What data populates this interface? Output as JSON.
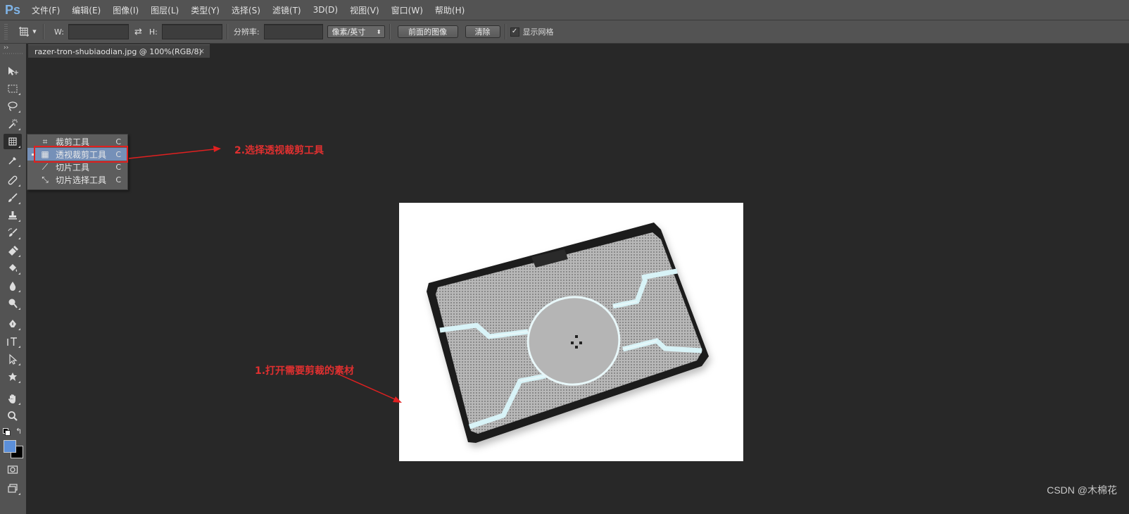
{
  "app": {
    "logo": "Ps"
  },
  "menubar": {
    "items": [
      "文件(F)",
      "编辑(E)",
      "图像(I)",
      "图层(L)",
      "类型(Y)",
      "选择(S)",
      "滤镜(T)",
      "3D(D)",
      "视图(V)",
      "窗口(W)",
      "帮助(H)"
    ]
  },
  "options": {
    "w_label": "W:",
    "w_value": "",
    "h_label": "H:",
    "h_value": "",
    "resolution_label": "分辨率:",
    "resolution_value": "",
    "unit_select": "像素/英寸",
    "front_image_button": "前面的图像",
    "clear_button": "清除",
    "show_grid_label": "显示网格",
    "show_grid_checked": true
  },
  "document": {
    "tab_title": "razer-tron-shubiaodian.jpg @ 100%(RGB/8)",
    "close_glyph": "×"
  },
  "flyout": {
    "items": [
      {
        "label": "裁剪工具",
        "shortcut": "C",
        "icon": "crop-icon",
        "selected": false
      },
      {
        "label": "透视裁剪工具",
        "shortcut": "C",
        "icon": "perspective-crop-icon",
        "selected": true
      },
      {
        "label": "切片工具",
        "shortcut": "C",
        "icon": "slice-icon",
        "selected": false
      },
      {
        "label": "切片选择工具",
        "shortcut": "C",
        "icon": "slice-select-icon",
        "selected": false
      }
    ]
  },
  "annotations": {
    "step1": "1.打开需要剪裁的素材",
    "step2": "2.选择透视裁剪工具",
    "color": "#e03030"
  },
  "colors": {
    "foreground": "#5b8fd9",
    "background": "#000000"
  },
  "watermark": "CSDN @木棉花"
}
